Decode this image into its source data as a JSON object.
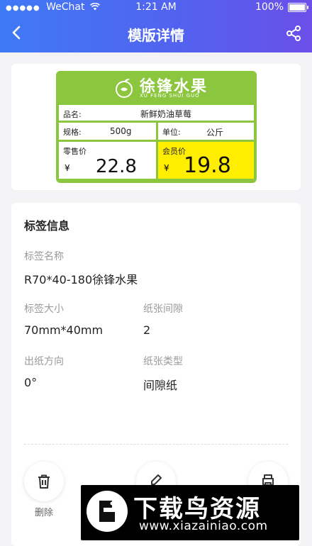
{
  "status_bar": {
    "carrier": "WeChat",
    "signal_dots": "●●●●●",
    "time": "1:21 AM",
    "battery": "100%"
  },
  "nav": {
    "title": "模版详情"
  },
  "price_tag": {
    "brand_name": "徐锋水果",
    "brand_sub": "XU FENG SHUI GUO",
    "product_label": "品名:",
    "product_name": "新鲜奶油草莓",
    "spec_label": "规格:",
    "spec_value": "500g",
    "unit_label": "单位:",
    "unit_value": "公斤",
    "retail_label": "零售价",
    "retail_currency": "¥",
    "retail_price": "22.8",
    "member_label": "会员价",
    "member_currency": "¥",
    "member_price": "19.8",
    "colors": {
      "green": "#8cc63f",
      "member_bg": "#ffee00"
    }
  },
  "info": {
    "title": "标签信息",
    "name_label": "标签名称",
    "name_value": "R70*40-180徐锋水果",
    "size_label": "标签大小",
    "size_value": "70mm*40mm",
    "gap_label": "纸张间隙",
    "gap_value": "2",
    "direction_label": "出纸方向",
    "direction_value": "0°",
    "paper_type_label": "纸张类型",
    "paper_type_value": "间隙纸"
  },
  "actions": {
    "delete_label": "删除"
  },
  "watermark": {
    "title": "下载鸟资源",
    "url": "www.xiazainiao.com"
  }
}
